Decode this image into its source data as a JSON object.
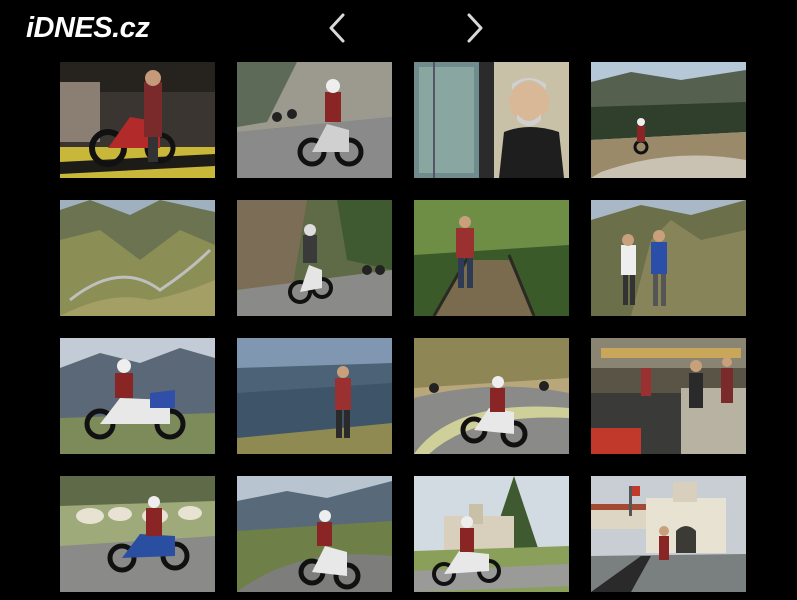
{
  "header": {
    "logo_text": "iDNES.cz",
    "prev_icon": "chevron-left-icon",
    "next_icon": "chevron-right-icon"
  },
  "colors": {
    "background": "#000000",
    "logo": "#ffffff",
    "nav": "#d9d9d9"
  }
}
